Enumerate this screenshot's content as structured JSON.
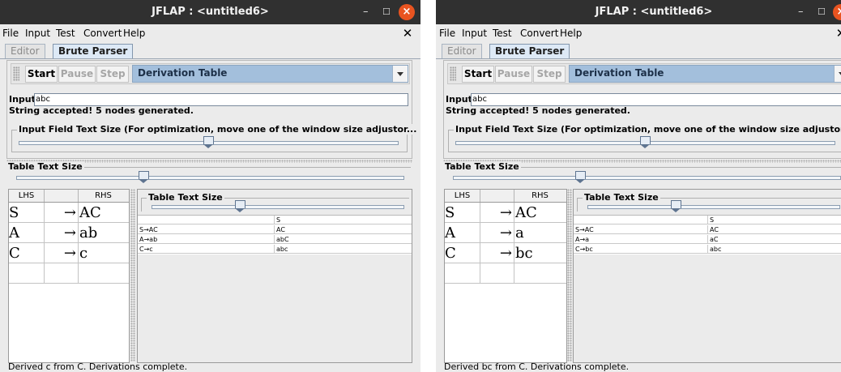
{
  "windows": [
    {
      "title": "JFLAP : <untitled6>",
      "menu": [
        "File",
        "Input",
        "Test",
        "Convert",
        "Help"
      ],
      "tabs": [
        "Editor",
        "Brute Parser"
      ],
      "toolbar": {
        "start": "Start",
        "pause": "Pause",
        "step": "Step",
        "view_selected": "Derivation Table"
      },
      "input": {
        "label": "Input",
        "value": "abc"
      },
      "status": "String accepted!  5 nodes generated.",
      "input_size": {
        "legend": "Input Field Text Size (For optimization, move one of the window size adjustor...",
        "value_fraction": 0.5
      },
      "table_size": {
        "legend": "Table Text Size",
        "value_fraction": 0.33
      },
      "grammar": {
        "headers": [
          "LHS",
          "",
          "RHS"
        ],
        "rows": [
          [
            "S",
            "→",
            "AC"
          ],
          [
            "A",
            "→",
            "ab"
          ],
          [
            "C",
            "→",
            "c"
          ],
          [
            "",
            "",
            ""
          ]
        ]
      },
      "derivation_panel": {
        "legend": "Table Text Size",
        "value_fraction": 0.35,
        "rows": [
          [
            "",
            "S"
          ],
          [
            "S→AC",
            "AC"
          ],
          [
            "A→ab",
            "abC"
          ],
          [
            "C→c",
            "abc"
          ]
        ]
      },
      "bottom_status": "Derived c from C.  Derivations complete."
    },
    {
      "title": "JFLAP : <untitled6>",
      "menu": [
        "File",
        "Input",
        "Test",
        "Convert",
        "Help"
      ],
      "tabs": [
        "Editor",
        "Brute Parser"
      ],
      "toolbar": {
        "start": "Start",
        "pause": "Pause",
        "step": "Step",
        "view_selected": "Derivation Table"
      },
      "input": {
        "label": "Input",
        "value": "abc"
      },
      "status": "String accepted!  5 nodes generated.",
      "input_size": {
        "legend": "Input Field Text Size (For optimization, move one of the window size adjustor...",
        "value_fraction": 0.5
      },
      "table_size": {
        "legend": "Table Text Size",
        "value_fraction": 0.33
      },
      "grammar": {
        "headers": [
          "LHS",
          "",
          "RHS"
        ],
        "rows": [
          [
            "S",
            "→",
            "AC"
          ],
          [
            "A",
            "→",
            "a"
          ],
          [
            "C",
            "→",
            "bc"
          ],
          [
            "",
            "",
            ""
          ]
        ]
      },
      "derivation_panel": {
        "legend": "Table Text Size",
        "value_fraction": 0.35,
        "rows": [
          [
            "",
            "S"
          ],
          [
            "S→AC",
            "AC"
          ],
          [
            "A→a",
            "aC"
          ],
          [
            "C→bc",
            "abc"
          ]
        ]
      },
      "bottom_status": "Derived bc from C.  Derivations complete."
    }
  ],
  "colors": {
    "titlebar": "#303030",
    "close_button": "#e95420",
    "selected_combo": "#a3bfdc"
  }
}
